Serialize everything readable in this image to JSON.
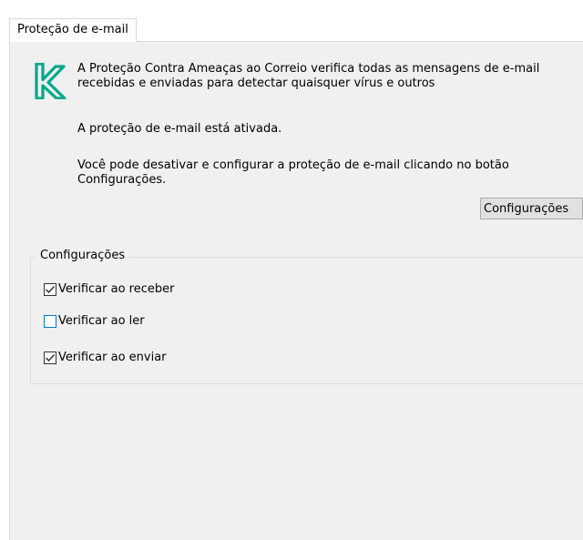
{
  "tab": {
    "label": "Proteção de e-mail"
  },
  "brand": {
    "logo_icon": "kaspersky-k-logo-icon",
    "logo_color": "#00a88e"
  },
  "main": {
    "description": "A Proteção Contra Ameaças ao Correio verifica todas as mensagens de e-mail recebidas e enviadas para detectar quaisquer vírus e outros",
    "status": "A proteção de e-mail está ativada.",
    "hint": "Você pode desativar e configurar a proteção de e-mail clicando no botão Configurações.",
    "settings_button_label": "Configurações"
  },
  "settings_group": {
    "legend": "Configurações",
    "options": [
      {
        "label": "Verificar ao receber",
        "checked": true
      },
      {
        "label": "Verificar ao ler",
        "checked": false
      },
      {
        "label": "Verificar ao enviar",
        "checked": true
      }
    ]
  }
}
